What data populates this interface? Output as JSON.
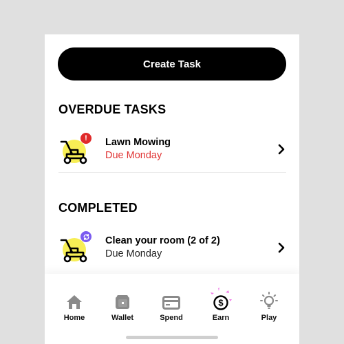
{
  "create_task": {
    "label": "Create Task"
  },
  "sections": {
    "overdue": {
      "title": "OVERDUE TASKS",
      "tasks": [
        {
          "name": "Lawn Mowing",
          "due": "Due Monday",
          "badge": "!",
          "badge_type": "alert",
          "icon": "lawn-mower-icon"
        }
      ]
    },
    "completed": {
      "title": "COMPLETED",
      "tasks": [
        {
          "name": "Clean your room (2 of 2)",
          "due": "Due Monday",
          "badge_type": "repeat",
          "icon": "lawn-mower-icon"
        }
      ]
    }
  },
  "tabs": [
    {
      "label": "Home",
      "icon": "home-icon"
    },
    {
      "label": "Wallet",
      "icon": "wallet-icon"
    },
    {
      "label": "Spend",
      "icon": "credit-card-icon"
    },
    {
      "label": "Earn",
      "icon": "dollar-coin-icon",
      "active": true
    },
    {
      "label": "Play",
      "icon": "lightbulb-icon"
    }
  ],
  "colors": {
    "primary": "#000000",
    "overdue": "#e03434",
    "alert_badge": "#e02a2a",
    "repeat_badge": "#7b5cf0",
    "icon_highlight": "#f7ee55",
    "earn_sparkle": "#f07de8",
    "inactive_icon": "#8a8a8a"
  }
}
